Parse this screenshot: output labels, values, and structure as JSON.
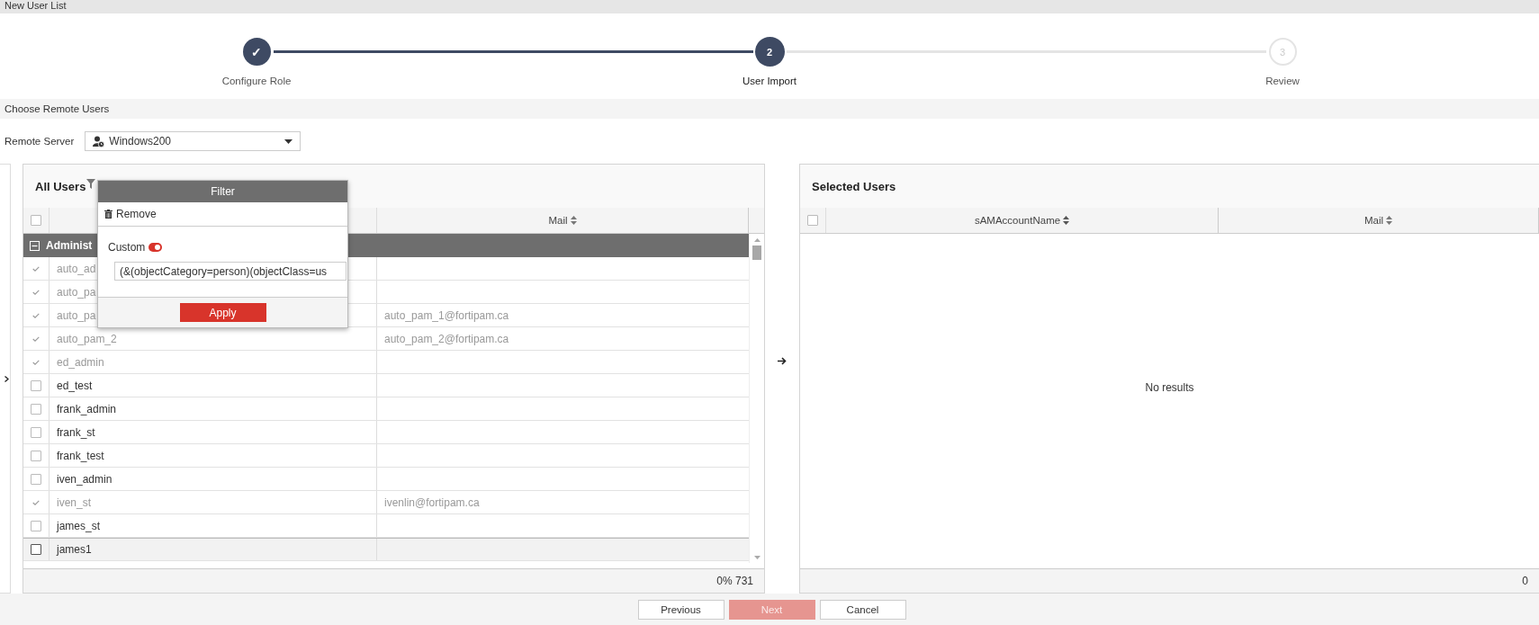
{
  "window": {
    "title": "New User List"
  },
  "steps": [
    {
      "label": "Configure Role",
      "marker": "✓",
      "completed": true,
      "selected": false
    },
    {
      "label": "User Import",
      "marker": "2",
      "completed": false,
      "selected": true
    },
    {
      "label": "Review",
      "marker": "3",
      "completed": false,
      "selected": false
    }
  ],
  "section": {
    "title": "Choose Remote Users"
  },
  "remote_server": {
    "label": "Remote Server",
    "value": "Windows200"
  },
  "all_users": {
    "title": "All Users",
    "select_all_checked": false,
    "columns": [
      "",
      "Mail"
    ],
    "group": {
      "label": "Administ",
      "expanded": true
    },
    "rows": [
      {
        "name": "auto_ad",
        "mail": "",
        "imported": true,
        "highlighted": false
      },
      {
        "name": "auto_pa",
        "mail": "",
        "imported": true,
        "highlighted": false
      },
      {
        "name": "auto_pa",
        "mail": "auto_pam_1@fortipam.ca",
        "imported": true,
        "highlighted": false
      },
      {
        "name": "auto_pam_2",
        "mail": "auto_pam_2@fortipam.ca",
        "imported": true,
        "highlighted": false
      },
      {
        "name": "ed_admin",
        "mail": "",
        "imported": true,
        "highlighted": false
      },
      {
        "name": "ed_test",
        "mail": "",
        "imported": false,
        "highlighted": false
      },
      {
        "name": "frank_admin",
        "mail": "",
        "imported": false,
        "highlighted": false
      },
      {
        "name": "frank_st",
        "mail": "",
        "imported": false,
        "highlighted": false
      },
      {
        "name": "frank_test",
        "mail": "",
        "imported": false,
        "highlighted": false
      },
      {
        "name": "iven_admin",
        "mail": "",
        "imported": false,
        "highlighted": false
      },
      {
        "name": "iven_st",
        "mail": "ivenlin@fortipam.ca",
        "imported": true,
        "highlighted": false
      },
      {
        "name": "james_st",
        "mail": "",
        "imported": false,
        "highlighted": false
      },
      {
        "name": "james1",
        "mail": "",
        "imported": false,
        "highlighted": true
      }
    ],
    "footer": "0% 731"
  },
  "filter": {
    "title": "Filter",
    "remove": "Remove",
    "custom_label": "Custom",
    "custom_on": true,
    "query": "(&(objectCategory=person)(objectClass=us",
    "apply": "Apply"
  },
  "selected_users": {
    "title": "Selected Users",
    "select_all_checked": false,
    "columns": [
      "sAMAccountName",
      "Mail"
    ],
    "empty": "No results",
    "footer": "0"
  },
  "buttons": [
    {
      "label": "Previous",
      "disabled": false
    },
    {
      "label": "Next",
      "disabled": true
    },
    {
      "label": "Cancel",
      "disabled": false
    }
  ]
}
